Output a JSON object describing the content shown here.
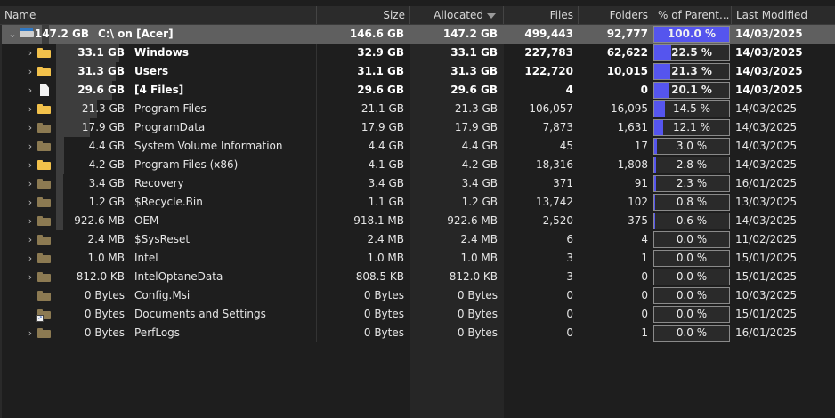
{
  "columns": {
    "name": "Name",
    "size": "Size",
    "allocated": "Allocated",
    "files": "Files",
    "folders": "Folders",
    "percent": "% of Parent...",
    "modified": "Last Modified"
  },
  "sort_icon": "sort-descending-icon",
  "colors": {
    "percent_fill": "#5555ee",
    "selected_row": "#5f5f5f",
    "folder": "#f2c14b"
  },
  "rows": [
    {
      "disp_size": "147.2 GB",
      "name": "C:\\  on  [Acer]",
      "size": "146.6 GB",
      "allocated": "147.2 GB",
      "files": "499,443",
      "folders": "92,777",
      "percent": "100.0 %",
      "percent_value": 1.0,
      "modified": "14/03/2025"
    },
    {
      "disp_size": "33.1 GB",
      "name": "Windows",
      "size": "32.9 GB",
      "allocated": "33.1 GB",
      "files": "227,783",
      "folders": "62,622",
      "percent": "22.5 %",
      "percent_value": 0.225,
      "modified": "14/03/2025"
    },
    {
      "disp_size": "31.3 GB",
      "name": "Users",
      "size": "31.1 GB",
      "allocated": "31.3 GB",
      "files": "122,720",
      "folders": "10,015",
      "percent": "21.3 %",
      "percent_value": 0.213,
      "modified": "14/03/2025"
    },
    {
      "disp_size": "29.6 GB",
      "name": "[4 Files]",
      "size": "29.6 GB",
      "allocated": "29.6 GB",
      "files": "4",
      "folders": "0",
      "percent": "20.1 %",
      "percent_value": 0.201,
      "modified": "14/03/2025"
    },
    {
      "disp_size": "21.3 GB",
      "name": "Program Files",
      "size": "21.1 GB",
      "allocated": "21.3 GB",
      "files": "106,057",
      "folders": "16,095",
      "percent": "14.5 %",
      "percent_value": 0.145,
      "modified": "14/03/2025"
    },
    {
      "disp_size": "17.9 GB",
      "name": "ProgramData",
      "size": "17.9 GB",
      "allocated": "17.9 GB",
      "files": "7,873",
      "folders": "1,631",
      "percent": "12.1 %",
      "percent_value": 0.121,
      "modified": "14/03/2025"
    },
    {
      "disp_size": "4.4 GB",
      "name": "System Volume Information",
      "size": "4.4 GB",
      "allocated": "4.4 GB",
      "files": "45",
      "folders": "17",
      "percent": "3.0 %",
      "percent_value": 0.03,
      "modified": "14/03/2025"
    },
    {
      "disp_size": "4.2 GB",
      "name": "Program Files (x86)",
      "size": "4.1 GB",
      "allocated": "4.2 GB",
      "files": "18,316",
      "folders": "1,808",
      "percent": "2.8 %",
      "percent_value": 0.028,
      "modified": "14/03/2025"
    },
    {
      "disp_size": "3.4 GB",
      "name": "Recovery",
      "size": "3.4 GB",
      "allocated": "3.4 GB",
      "files": "371",
      "folders": "91",
      "percent": "2.3 %",
      "percent_value": 0.023,
      "modified": "16/01/2025"
    },
    {
      "disp_size": "1.2 GB",
      "name": "$Recycle.Bin",
      "size": "1.1 GB",
      "allocated": "1.2 GB",
      "files": "13,742",
      "folders": "102",
      "percent": "0.8 %",
      "percent_value": 0.008,
      "modified": "13/03/2025"
    },
    {
      "disp_size": "922.6 MB",
      "name": "OEM",
      "size": "918.1 MB",
      "allocated": "922.6 MB",
      "files": "2,520",
      "folders": "375",
      "percent": "0.6 %",
      "percent_value": 0.006,
      "modified": "14/03/2025"
    },
    {
      "disp_size": "2.4 MB",
      "name": "$SysReset",
      "size": "2.4 MB",
      "allocated": "2.4 MB",
      "files": "6",
      "folders": "4",
      "percent": "0.0 %",
      "percent_value": 0.0,
      "modified": "11/02/2025"
    },
    {
      "disp_size": "1.0 MB",
      "name": "Intel",
      "size": "1.0 MB",
      "allocated": "1.0 MB",
      "files": "3",
      "folders": "1",
      "percent": "0.0 %",
      "percent_value": 0.0,
      "modified": "15/01/2025"
    },
    {
      "disp_size": "812.0 KB",
      "name": "IntelOptaneData",
      "size": "808.5 KB",
      "allocated": "812.0 KB",
      "files": "3",
      "folders": "0",
      "percent": "0.0 %",
      "percent_value": 0.0,
      "modified": "15/01/2025"
    },
    {
      "disp_size": "0 Bytes",
      "name": "Config.Msi",
      "size": "0 Bytes",
      "allocated": "0 Bytes",
      "files": "0",
      "folders": "0",
      "percent": "0.0 %",
      "percent_value": 0.0,
      "modified": "10/03/2025"
    },
    {
      "disp_size": "0 Bytes",
      "name": "Documents and Settings",
      "size": "0 Bytes",
      "allocated": "0 Bytes",
      "files": "0",
      "folders": "0",
      "percent": "0.0 %",
      "percent_value": 0.0,
      "modified": "15/01/2025"
    },
    {
      "disp_size": "0 Bytes",
      "name": "PerfLogs",
      "size": "0 Bytes",
      "allocated": "0 Bytes",
      "files": "0",
      "folders": "1",
      "percent": "0.0 %",
      "percent_value": 0.0,
      "modified": "16/01/2025"
    }
  ]
}
